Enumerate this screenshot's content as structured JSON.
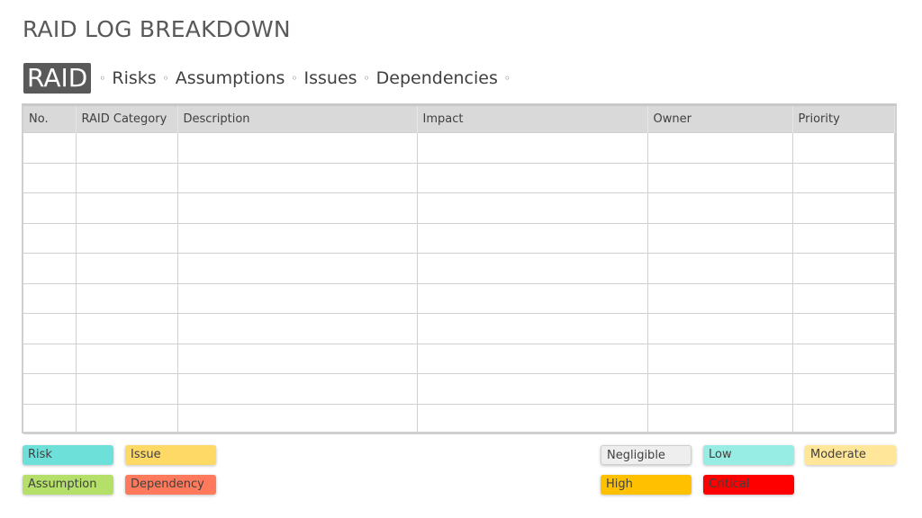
{
  "header": {
    "title": "RAID LOG BREAKDOWN",
    "badge": "RAID",
    "bullet": "◦",
    "items": [
      "Risks",
      "Assumptions",
      "Issues",
      "Dependencies"
    ]
  },
  "table": {
    "columns": [
      "No.",
      "RAID Category",
      "Description",
      "Impact",
      "Owner",
      "Priority"
    ],
    "rows": [
      [
        "",
        "",
        "",
        "",
        "",
        ""
      ],
      [
        "",
        "",
        "",
        "",
        "",
        ""
      ],
      [
        "",
        "",
        "",
        "",
        "",
        ""
      ],
      [
        "",
        "",
        "",
        "",
        "",
        ""
      ],
      [
        "",
        "",
        "",
        "",
        "",
        ""
      ],
      [
        "",
        "",
        "",
        "",
        "",
        ""
      ],
      [
        "",
        "",
        "",
        "",
        "",
        ""
      ],
      [
        "",
        "",
        "",
        "",
        "",
        ""
      ],
      [
        "",
        "",
        "",
        "",
        "",
        ""
      ],
      [
        "",
        "",
        "",
        "",
        "",
        ""
      ]
    ]
  },
  "category_legend": [
    {
      "label": "Risk",
      "color": "#6ee0da"
    },
    {
      "label": "Issue",
      "color": "#ffd966"
    },
    {
      "label": "Assumption",
      "color": "#b4e06a"
    },
    {
      "label": "Dependency",
      "color": "#ff7a5c"
    }
  ],
  "priority_legend": [
    {
      "label": "Negligible",
      "color": "#eeeeee"
    },
    {
      "label": "Low",
      "color": "#97ece3"
    },
    {
      "label": "Moderate",
      "color": "#ffe699"
    },
    {
      "label": "High",
      "color": "#ffc000"
    },
    {
      "label": "Critical",
      "color": "#ff0000"
    }
  ]
}
